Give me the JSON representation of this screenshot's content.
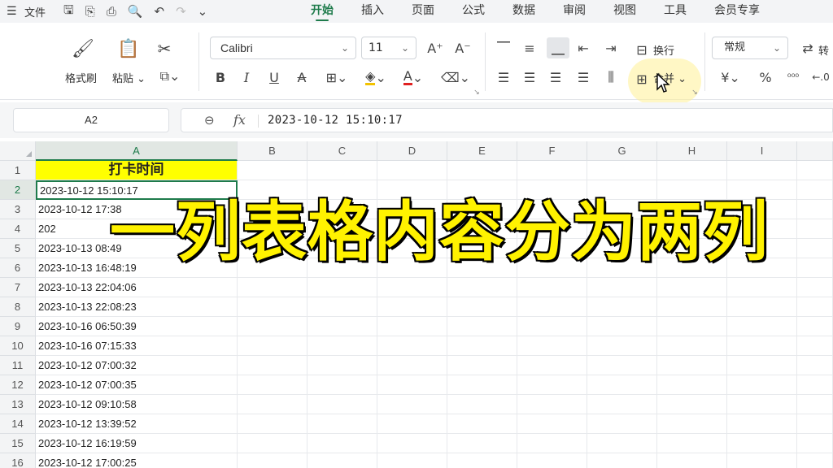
{
  "menubar": {
    "file_label": "文件",
    "tabs": [
      {
        "label": "开始",
        "active": true
      },
      {
        "label": "插入",
        "active": false
      },
      {
        "label": "页面",
        "active": false
      },
      {
        "label": "公式",
        "active": false
      },
      {
        "label": "数据",
        "active": false
      },
      {
        "label": "审阅",
        "active": false
      },
      {
        "label": "视图",
        "active": false
      },
      {
        "label": "工具",
        "active": false
      },
      {
        "label": "会员专享",
        "active": false
      }
    ]
  },
  "ribbon": {
    "format_painter_label": "格式刷",
    "paste_label": "粘贴",
    "font_name": "Calibri",
    "font_size": "11",
    "wrap_label": "换行",
    "merge_label": "合并",
    "number_format": "常规",
    "convert_label": "转",
    "accent_color": "#1e7b4b",
    "fill_color": "#f2c200",
    "font_color": "#e02020"
  },
  "formula_bar": {
    "name_box": "A2",
    "fx_label": "fx",
    "value": "2023-10-12 15:10:17"
  },
  "sheet": {
    "columns": [
      "A",
      "B",
      "C",
      "D",
      "E",
      "F",
      "G",
      "H",
      "I"
    ],
    "rows": [
      "1",
      "2",
      "3",
      "4",
      "5",
      "6",
      "7",
      "8",
      "9",
      "10",
      "11",
      "12",
      "13",
      "14",
      "15",
      "16"
    ],
    "header_cell": "打卡时间",
    "header_fill": "#ffff00",
    "cells": [
      "2023-10-12 15:10:17",
      "2023-10-12 17:38",
      "202",
      "2023-10-13 08:49",
      "2023-10-13 16:48:19",
      "2023-10-13 22:04:06",
      "2023-10-13 22:08:23",
      "2023-10-16 06:50:39",
      "2023-10-16 07:15:33",
      "2023-10-12 07:00:32",
      "2023-10-12 07:00:35",
      "2023-10-12 09:10:58",
      "2023-10-12 13:39:52",
      "2023-10-12 16:19:59",
      "2023-10-12 17:00:25"
    ]
  },
  "overlay_caption": "一列表格内容分为两列"
}
